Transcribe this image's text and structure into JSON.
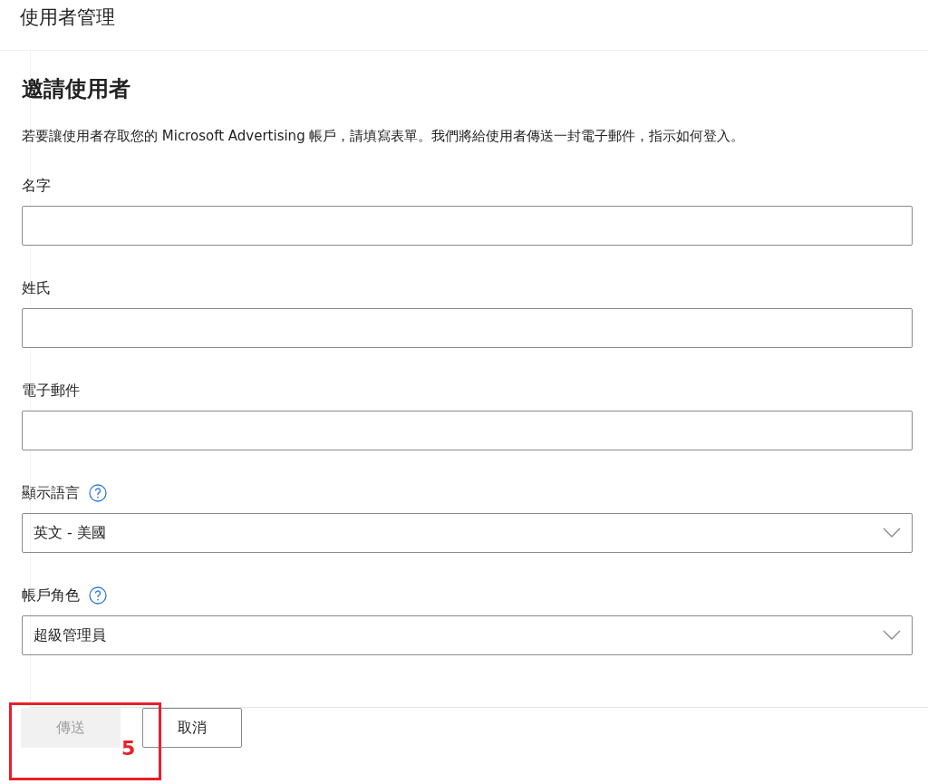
{
  "page_title": "使用者管理",
  "form": {
    "title": "邀請使用者",
    "description": "若要讓使用者存取您的 Microsoft Advertising 帳戶，請填寫表單。我們將給使用者傳送一封電子郵件，指示如何登入。",
    "fields": [
      {
        "kind": "text",
        "label": "名字",
        "help": false
      },
      {
        "kind": "text",
        "label": "姓氏",
        "help": false
      },
      {
        "kind": "text",
        "label": "電子郵件",
        "help": false
      },
      {
        "kind": "select",
        "label": "顯示語言",
        "help": true,
        "value": "英文 - 美國"
      },
      {
        "kind": "select",
        "label": "帳戶角色",
        "help": true,
        "value": "超級管理員"
      }
    ]
  },
  "buttons": [
    {
      "label": "傳送",
      "disabled": true
    },
    {
      "label": "取消",
      "disabled": false
    }
  ],
  "annotation": {
    "number": "5"
  }
}
